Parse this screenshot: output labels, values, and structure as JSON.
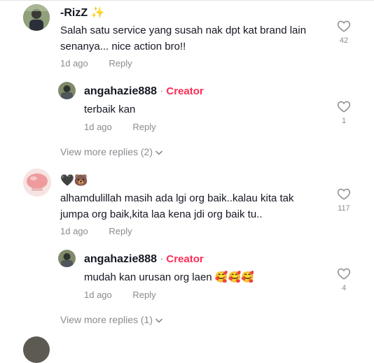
{
  "comments": [
    {
      "username": "-RizZ ✨",
      "text_line1": "Salah satu service yang susah nak dpt kat brand lain",
      "text_line2": "senanya... nice action bro!!",
      "time": "1d ago",
      "reply_label": "Reply",
      "likes": "42",
      "reply": {
        "username": "angahazie888",
        "badge": "Creator",
        "text": "terbaik kan",
        "time": "1d ago",
        "reply_label": "Reply",
        "likes": "1"
      },
      "view_more": "View more replies (2)"
    },
    {
      "username": "🖤🐻",
      "text_line1": "alhamdulillah masih ada lgi org baik..kalau kita tak",
      "text_line2": "jumpa org baik,kita laa kena jdi org baik tu..",
      "time": "1d ago",
      "reply_label": "Reply",
      "likes": "117",
      "reply": {
        "username": "angahazie888",
        "badge": "Creator",
        "text": "mudah kan urusan org laen 🥰🥰🥰",
        "time": "1d ago",
        "reply_label": "Reply",
        "likes": "4"
      },
      "view_more": "View more replies (1)"
    }
  ],
  "icons": {
    "like": "heart-outline-icon",
    "expand": "chevron-down-icon"
  },
  "colors": {
    "creator": "#fe2c55",
    "muted": "#8a8b91",
    "text": "#161823"
  }
}
